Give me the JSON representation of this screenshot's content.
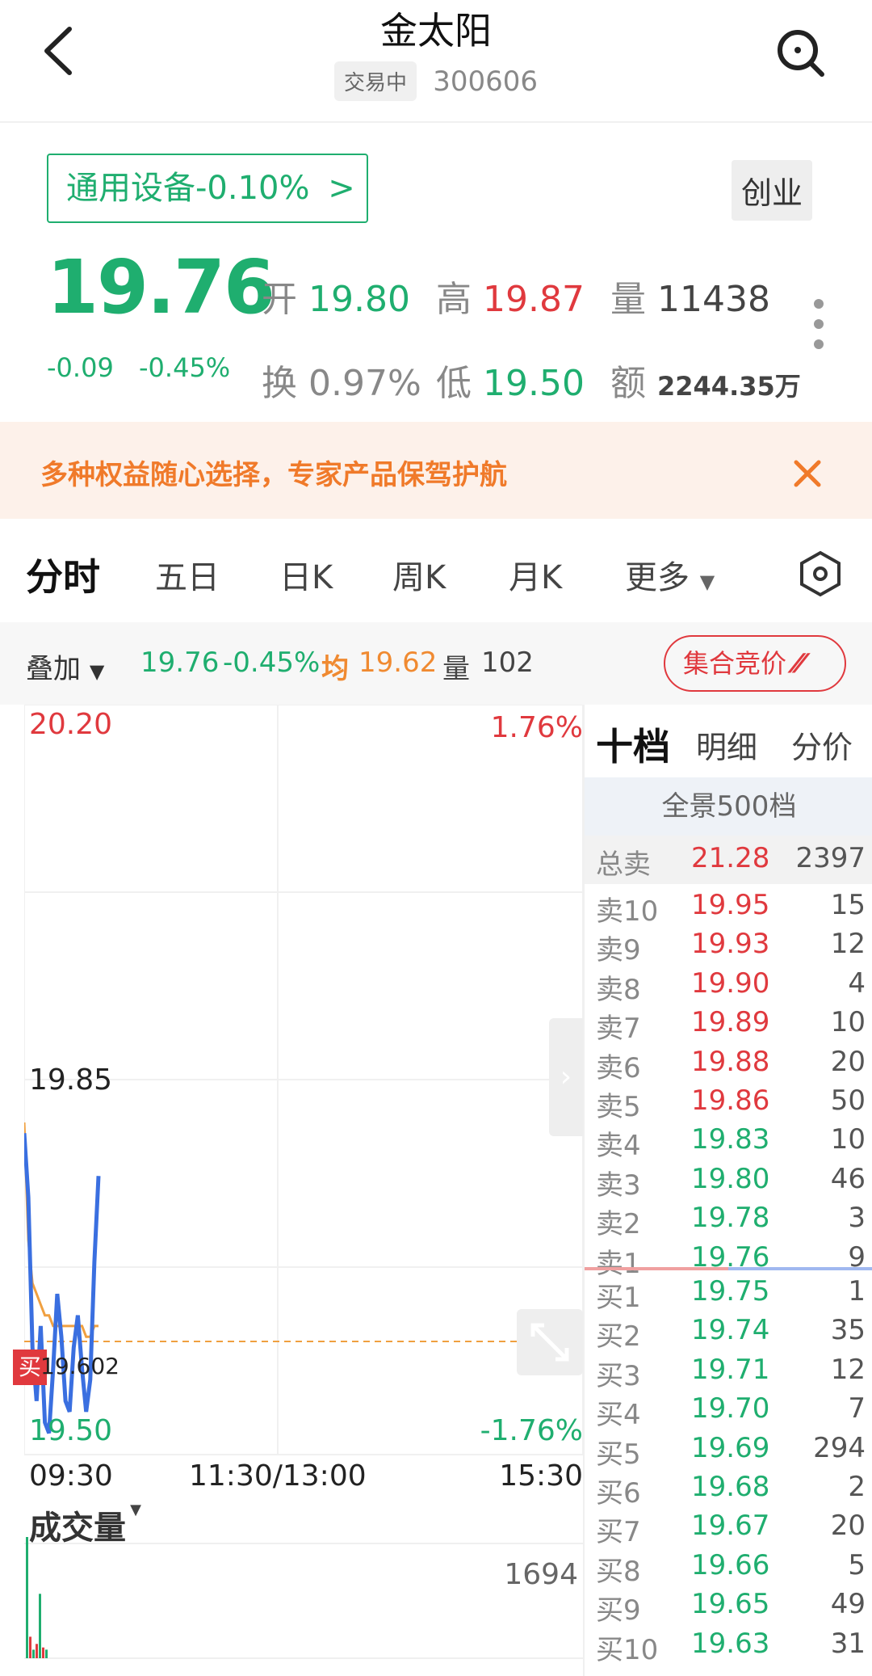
{
  "header": {
    "stock_name": "金太阳",
    "status": "交易中",
    "code": "300606"
  },
  "sector": {
    "label": "通用设备-0.10%",
    "chevron": ">"
  },
  "board": "创业",
  "quote": {
    "price": "19.76",
    "change": "-0.09",
    "change_pct": "-0.45%",
    "open_label": "开",
    "open": "19.80",
    "high_label": "高",
    "high": "19.87",
    "volume_label": "量",
    "volume": "11438",
    "turnover_label": "换",
    "turnover": "0.97%",
    "low_label": "低",
    "low": "19.50",
    "amount_label": "额",
    "amount": "2244.35万"
  },
  "promo": {
    "text": "多种权益随心选择，专家产品保驾护航"
  },
  "period_tabs": [
    "分时",
    "五日",
    "日K",
    "周K",
    "月K",
    "更多"
  ],
  "overlay": {
    "label": "叠加",
    "price": "19.76",
    "pct": "-0.45%",
    "avg_label": "均",
    "avg": "19.62",
    "vol_label": "量",
    "vol": "102",
    "auction": "集合竞价"
  },
  "chart": {
    "y_top": "20.20",
    "y_mid": "19.85",
    "y_bottom": "19.50",
    "pct_top": "1.76%",
    "pct_bottom": "-1.76%",
    "t_start": "09:30",
    "t_mid": "11:30/13:00",
    "t_end": "15:30",
    "buy_marker": "买",
    "buy_price": "19.602",
    "volume_title": "成交量",
    "volume_max": "1694"
  },
  "chart_data": {
    "type": "line",
    "ylim": [
      19.5,
      20.2
    ],
    "y_ticks": [
      "20.20",
      "19.85",
      "19.50"
    ],
    "x_ticks": [
      "09:30",
      "11:30/13:00",
      "15:30"
    ],
    "series": [
      {
        "values": [
          19.8,
          19.74,
          19.6,
          19.55,
          19.62,
          19.53,
          19.52,
          19.58,
          19.65,
          19.61,
          19.55,
          19.54,
          19.6,
          19.63,
          19.58,
          19.54,
          19.57,
          19.68,
          19.76
        ]
      },
      {
        "values": [
          19.81,
          19.7,
          19.66,
          19.65,
          19.64,
          19.63,
          19.63,
          19.62,
          19.62,
          19.62,
          19.62,
          19.62,
          19.62,
          19.62,
          19.62,
          19.61,
          19.61,
          19.62,
          19.62
        ]
      }
    ],
    "volume": [
      1694,
      300,
      120,
      200,
      900,
      150,
      120
    ]
  },
  "orderbook": {
    "tabs": [
      "十档",
      "明细",
      "分价"
    ],
    "panorama": "全景500档",
    "total_sell": {
      "label": "总卖",
      "price": "21.28",
      "vol": "2397"
    },
    "sells": [
      {
        "label": "卖10",
        "price": "19.95",
        "vol": "15"
      },
      {
        "label": "卖9",
        "price": "19.93",
        "vol": "12"
      },
      {
        "label": "卖8",
        "price": "19.90",
        "vol": "4"
      },
      {
        "label": "卖7",
        "price": "19.89",
        "vol": "10"
      },
      {
        "label": "卖6",
        "price": "19.88",
        "vol": "20"
      },
      {
        "label": "卖5",
        "price": "19.86",
        "vol": "50"
      },
      {
        "label": "卖4",
        "price": "19.83",
        "vol": "10"
      },
      {
        "label": "卖3",
        "price": "19.80",
        "vol": "46"
      },
      {
        "label": "卖2",
        "price": "19.78",
        "vol": "3"
      },
      {
        "label": "卖1",
        "price": "19.76",
        "vol": "9"
      }
    ],
    "buys": [
      {
        "label": "买1",
        "price": "19.75",
        "vol": "1"
      },
      {
        "label": "买2",
        "price": "19.74",
        "vol": "35"
      },
      {
        "label": "买3",
        "price": "19.71",
        "vol": "12"
      },
      {
        "label": "买4",
        "price": "19.70",
        "vol": "7"
      },
      {
        "label": "买5",
        "price": "19.69",
        "vol": "294"
      },
      {
        "label": "买6",
        "price": "19.68",
        "vol": "2"
      },
      {
        "label": "买7",
        "price": "19.67",
        "vol": "20"
      },
      {
        "label": "买8",
        "price": "19.66",
        "vol": "5"
      },
      {
        "label": "买9",
        "price": "19.65",
        "vol": "49"
      },
      {
        "label": "买10",
        "price": "19.63",
        "vol": "31"
      }
    ]
  },
  "colors": {
    "up": "#e0393e",
    "down": "#1fae6f",
    "price_line": "#3a6fe0",
    "avg_line": "#f0a040",
    "promo_text": "#f07a2a"
  }
}
